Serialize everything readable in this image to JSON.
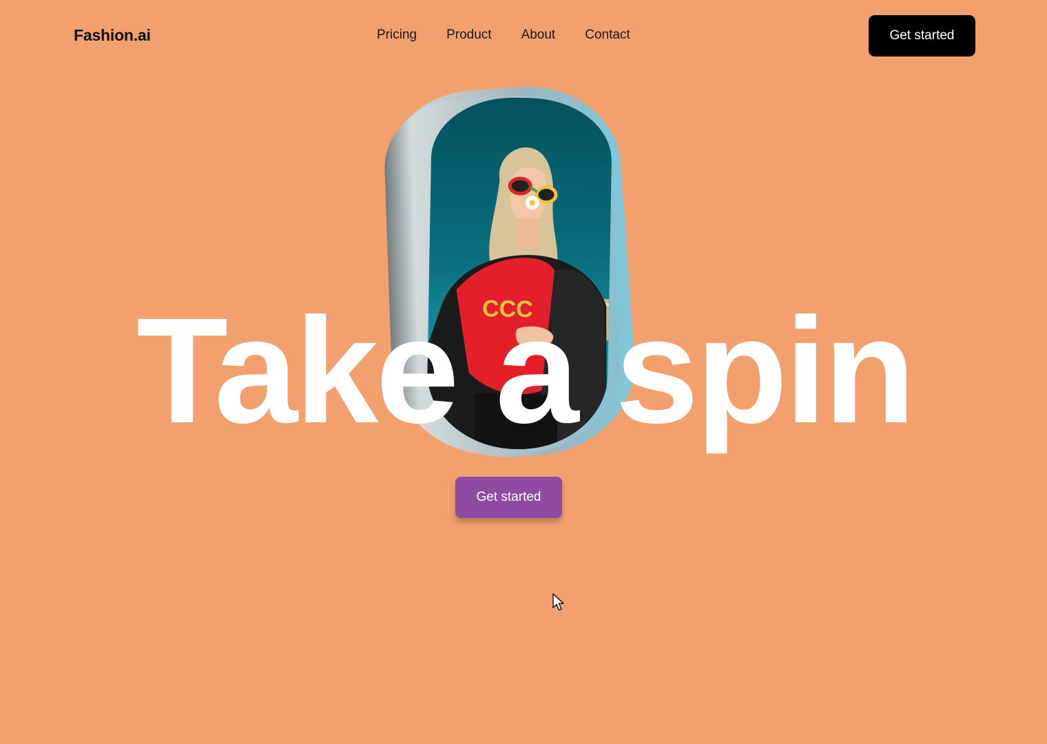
{
  "brand": {
    "name": "Fashion.ai"
  },
  "nav": {
    "items": [
      {
        "label": "Pricing"
      },
      {
        "label": "Product"
      },
      {
        "label": "About"
      },
      {
        "label": "Contact"
      }
    ],
    "cta_label": "Get started"
  },
  "hero": {
    "headline": "Take a spin",
    "cta_label": "Get started",
    "image": "photo-card-stack"
  },
  "colors": {
    "background": "#f2a06d",
    "headline": "#ffffff",
    "nav_cta": "#000000",
    "hero_cta": "#8f4aa1"
  },
  "icons": {
    "pointer": "mouse-pointer-icon"
  }
}
